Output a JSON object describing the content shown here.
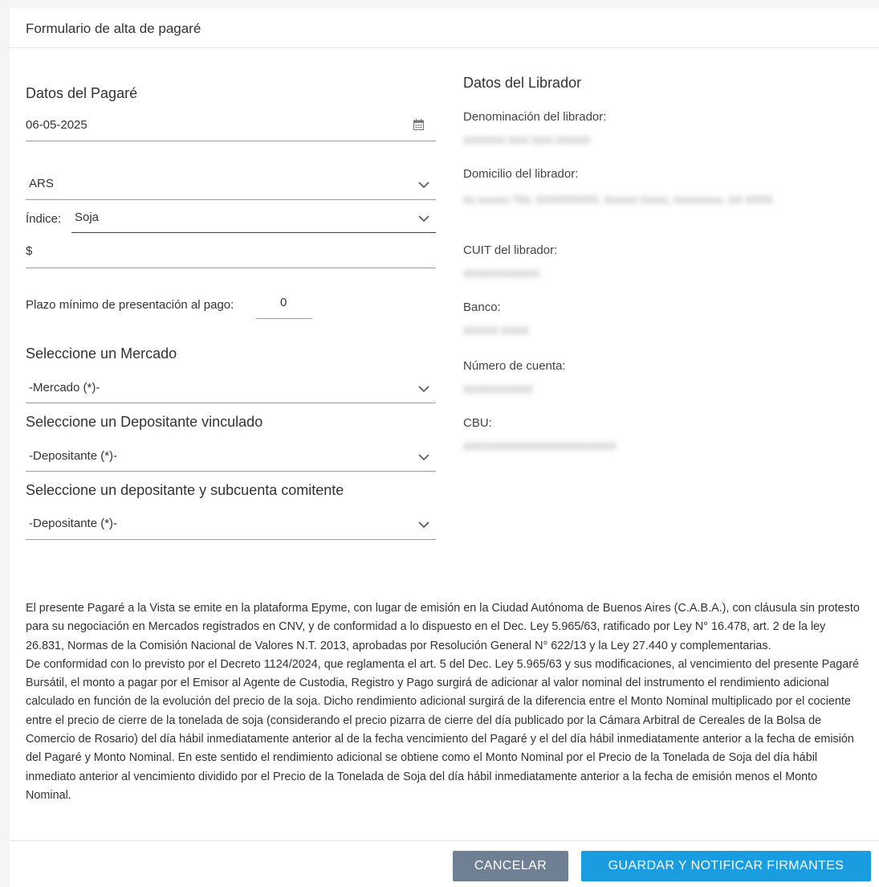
{
  "header": {
    "title": "Formulario de alta de pagaré"
  },
  "pagare": {
    "section_title": "Datos del Pagaré",
    "fecha": "06-05-2025",
    "moneda": "ARS",
    "indice_label": "Índice:",
    "indice_value": "Soja",
    "monto_prefix": "$",
    "plazo_label": "Plazo mínimo de presentación al pago:",
    "plazo_value": "0",
    "mercado_title": "Seleccione un Mercado",
    "mercado_placeholder": "-Mercado (*)-",
    "depositante_title": "Seleccione un Depositante vinculado",
    "depositante_placeholder": "-Depositante (*)-",
    "subcuenta_title": "Seleccione un depositante y subcuenta comitente",
    "subcuenta_placeholder": "-Depositante (*)-"
  },
  "librador": {
    "section_title": "Datos del Librador",
    "denominacion_label": "Denominación del librador:",
    "denominacion_value": "XXXXXX XXX XXX XXXXX",
    "domicilio_label": "Domicilio del librador:",
    "domicilio_value": "Xx xxxxxx 702, XXXXXXXXX, Xxxxxx Xxxxx, Xxxxxxxxx, XX XXXX",
    "cuit_label": "CUIT del librador:",
    "cuit_value": "XXXXXXXXXXX",
    "banco_label": "Banco:",
    "banco_value": "XXXXX XXXX",
    "cuenta_label": "Número de cuenta:",
    "cuenta_value": "XXXXXXXXXX",
    "cbu_label": "CBU:",
    "cbu_value": "XXXXXXXXXXXXXXXXXXXXXX"
  },
  "legal": {
    "paragraph1": "El presente Pagaré a la Vista se emite en la plataforma Epyme, con lugar de emisión en la Ciudad Autónoma de Buenos Aires (C.A.B.A.), con cláusula sin protesto para su negociación en Mercados registrados en CNV, y de conformidad a lo dispuesto en el Dec. Ley 5.965/63, ratificado por Ley N° 16.478, art. 2 de la ley 26.831, Normas de la Comisión Nacional de Valores N.T. 2013, aprobadas por Resolución General N° 622/13 y la Ley 27.440 y complementarias.",
    "paragraph2": "De conformidad con lo previsto por el Decreto 1124/2024, que reglamenta el art. 5 del Dec. Ley 5.965/63 y sus modificaciones, al vencimiento del presente Pagaré Bursátil, el monto a pagar por el Emisor al Agente de Custodia, Registro y Pago surgirá de adicionar al valor nominal del instrumento el rendimiento adicional calculado en función de la evolución del precio de la soja. Dicho rendimiento adicional surgirá de la diferencia entre el Monto Nominal multiplicado por el cociente entre el precio de cierre de la tonelada de soja (considerando el precio pizarra de cierre del día publicado por la Cámara Arbitral de Cereales de la Bolsa de Comercio de Rosario) del día hábil inmediatamente anterior al de la fecha vencimiento del Pagaré y el del día hábil inmediatamente anterior a la fecha de emisión del Pagaré y Monto Nominal. En este sentido el rendimiento adicional se obtiene como el Monto Nominal por el Precio de la Tonelada de Soja del día hábil inmediato anterior al vencimiento dividido por el Precio de la Tonelada de Soja del día hábil inmediatamente anterior a la fecha de emisión menos el Monto Nominal."
  },
  "footer": {
    "cancel_label": "CANCELAR",
    "save_label": "GUARDAR Y NOTIFICAR FIRMANTES"
  },
  "icons": {
    "calendar": "calendar-icon",
    "chevron": "chevron-down-icon"
  },
  "colors": {
    "primary": "#1a9de0",
    "secondary": "#6f7f94"
  }
}
